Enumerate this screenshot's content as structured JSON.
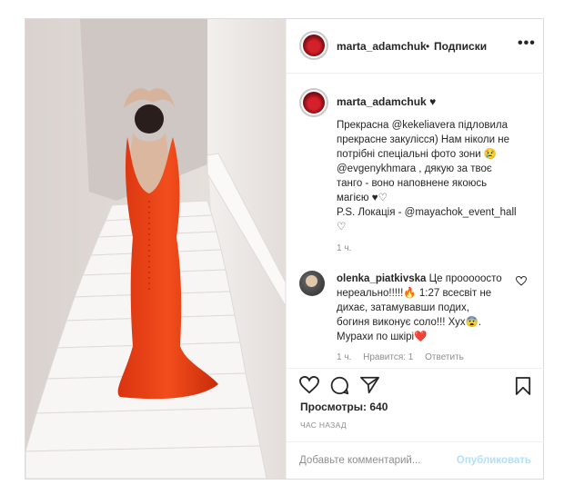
{
  "post": {
    "username": "marta_adamchuk",
    "follow_label": "Подписки",
    "more_label": "•••",
    "caption_username": "marta_adamchuk",
    "caption_heart": "♥",
    "caption_lines": [
      "Прекрасна @kekeliavera підловила",
      "прекрасне закулісся) Нам ніколи не",
      "потрібні спеціальні фото зони 😢",
      "@evgenykhmara , дякую за твоє",
      "танго - воно наповнене якоюсь",
      "магією ♥♡",
      "P.S. Локація - @mayachok_event_hall",
      "♡"
    ],
    "caption_time": "1 ч."
  },
  "comment": {
    "username": "olenka_piatkivska",
    "text_lines": [
      "Це прооооосто",
      "нереально!!!!!🔥 1:27 всесвіт не",
      "дихає, затамувавши подих,",
      "богиня виконує соло!!! Хух😨.",
      "Мурахи по шкірі❤️"
    ],
    "time": "1 ч.",
    "likes": "Нравится: 1",
    "reply": "Ответить"
  },
  "stats": {
    "views_label": "Просмотры:",
    "views_value": "640",
    "ago": "ЧАС НАЗАД"
  },
  "composer": {
    "placeholder": "Добавьте комментарий...",
    "publish_label": "Опубликовать"
  },
  "icons": [
    "heart-icon",
    "comment-icon",
    "share-icon",
    "bookmark-icon",
    "more-icon"
  ]
}
